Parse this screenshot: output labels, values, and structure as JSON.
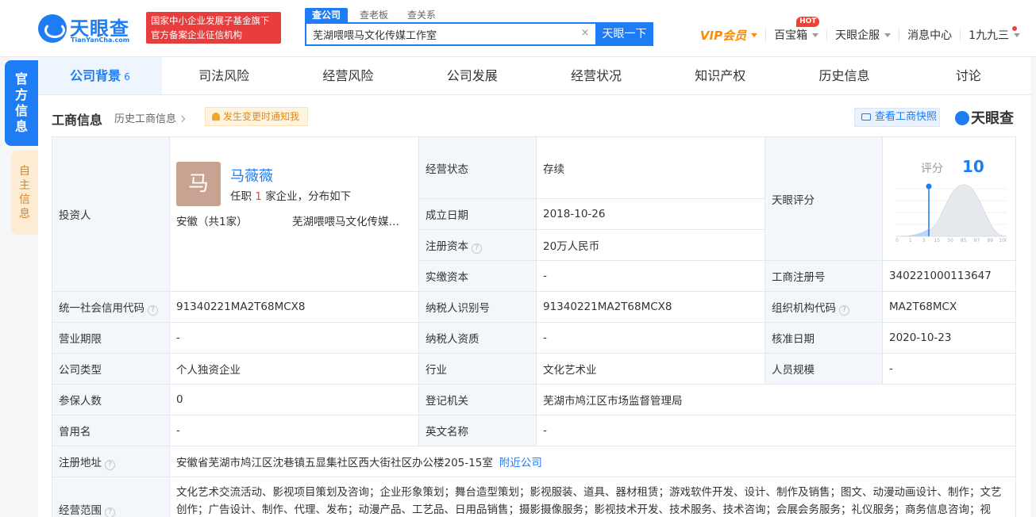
{
  "header": {
    "logo_name": "天眼查",
    "logo_url": "TianYanCha.com",
    "badge_line1": "国家中小企业发展子基金旗下",
    "badge_line2": "官方备案企业征信机构",
    "search_tabs": [
      "查公司",
      "查老板",
      "查关系"
    ],
    "search_value": "芜湖喂喂马文化传媒工作室",
    "clear_symbol": "×",
    "search_button": "天眼一下",
    "nav": {
      "vip": "VIP会员",
      "treasure": "百宝箱",
      "hot": "HOT",
      "enterprise": "天眼企服",
      "messages": "消息中心",
      "user": "1九九三"
    }
  },
  "side_tabs": {
    "official": [
      "官",
      "方",
      "信",
      "息"
    ],
    "self": [
      "自",
      "主",
      "信",
      "息"
    ]
  },
  "tabs": [
    {
      "label": "公司背景",
      "count": "6"
    },
    {
      "label": "司法风险"
    },
    {
      "label": "经营风险"
    },
    {
      "label": "公司发展"
    },
    {
      "label": "经营状况"
    },
    {
      "label": "知识产权"
    },
    {
      "label": "历史信息"
    },
    {
      "label": "讨论"
    }
  ],
  "section": {
    "title": "工商信息",
    "history_link": "历史工商信息",
    "notify": "发生变更时通知我",
    "snapshot": "查看工商快照",
    "brand": "天眼查"
  },
  "investor": {
    "label": "投资人",
    "avatar_char": "马",
    "name": "马薇薇",
    "desc_prefix": "任职",
    "desc_count": "1",
    "desc_suffix": "家企业，分布如下",
    "region": "安徽（共1家）",
    "company": "芜湖喂喂马文化传媒工作室"
  },
  "score": {
    "label": "天眼评分",
    "chart_label": "评分",
    "value": 10,
    "axis_ticks": [
      "0",
      "1",
      "3",
      "15",
      "50",
      "85",
      "97",
      "99",
      "100"
    ]
  },
  "fields": {
    "status_label": "经营状态",
    "status": "存续",
    "founded_label": "成立日期",
    "founded": "2018-10-26",
    "reg_capital_label": "注册资本",
    "reg_capital": "20万人民币",
    "paid_capital_label": "实缴资本",
    "paid_capital": "-",
    "reg_no_label": "工商注册号",
    "reg_no": "340221000113647",
    "credit_code_label": "统一社会信用代码",
    "credit_code": "91340221MA2T68MCX8",
    "taxpayer_id_label": "纳税人识别号",
    "taxpayer_id": "91340221MA2T68MCX8",
    "org_code_label": "组织机构代码",
    "org_code": "MA2T68MCX",
    "term_label": "营业期限",
    "term": "-",
    "tax_qual_label": "纳税人资质",
    "tax_qual": "-",
    "approve_label": "核准日期",
    "approve": "2020-10-23",
    "type_label": "公司类型",
    "type": "个人独资企业",
    "industry_label": "行业",
    "industry": "文化艺术业",
    "staff_label": "人员规模",
    "staff": "-",
    "insured_label": "参保人数",
    "insured": "0",
    "authority_label": "登记机关",
    "authority": "芜湖市鸠江区市场监督管理局",
    "former_label": "曾用名",
    "former": "-",
    "english_label": "英文名称",
    "english": "-",
    "address_label": "注册地址",
    "address": "安徽省芜湖市鸠江区沈巷镇五显集社区西大街社区办公楼205-15室",
    "nearby_link": "附近公司",
    "scope_label": "经营范围",
    "scope": "文化艺术交流活动、影视项目策划及咨询；企业形象策划；舞台造型策划；影视服装、道具、器材租赁；游戏软件开发、设计、制作及销售；图文、动漫动画设计、制作；文艺创作；广告设计、制作、代理、发布；动漫产品、工艺品、日用品销售；摄影摄像服务；影视技术开发、技术服务、技术咨询；会展会务服务；礼仪服务；商务信息咨询；视频、音频制作。（依法须经批准的项目，经相关部门批准后方可开展经营活动）"
  },
  "colors": {
    "primary": "#1e7cf5",
    "badge_red": "#e83d3d",
    "vip_orange": "#ff8a00",
    "label_bg": "#f3f6fa"
  }
}
